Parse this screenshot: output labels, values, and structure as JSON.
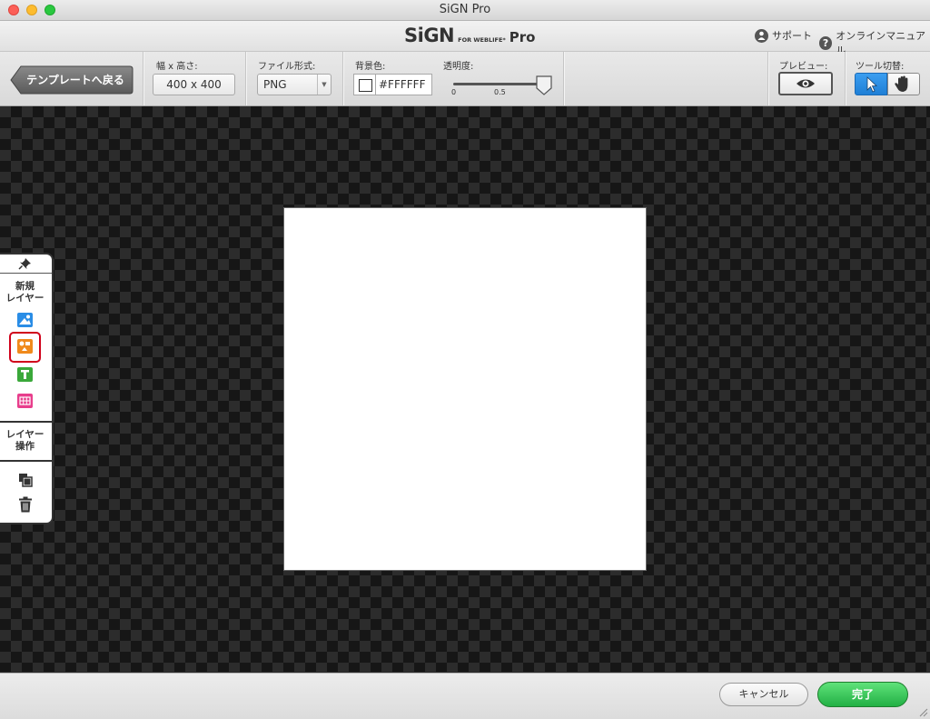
{
  "window": {
    "title": "SiGN Pro"
  },
  "header": {
    "logo_main": "SiGN",
    "logo_sub": "FOR WEBLIFE*",
    "logo_pro": "Pro",
    "support_label": "サポート",
    "manual_label": "オンラインマニュアル"
  },
  "toolbar": {
    "back_label": "テンプレートへ戻る",
    "size_label": "幅 x 高さ:",
    "size_value": "400 x 400",
    "format_label": "ファイル形式:",
    "format_value": "PNG",
    "bg_label": "背景色:",
    "bg_value": "#FFFFFF",
    "opacity_label": "透明度:",
    "opacity_min": "0",
    "opacity_mid": "0.5",
    "opacity_value": 1.0,
    "preview_label": "プレビュー:",
    "tool_label": "ツール切替:"
  },
  "side_panel": {
    "new_layer_label_1": "新規",
    "new_layer_label_2": "レイヤー",
    "layer_ops_label_1": "レイヤー",
    "layer_ops_label_2": "操作",
    "icons": [
      "pin-icon",
      "image-layer-icon",
      "shape-layer-icon",
      "text-layer-icon",
      "table-layer-icon",
      "duplicate-icon",
      "trash-icon"
    ]
  },
  "footer": {
    "cancel_label": "キャンセル",
    "done_label": "完了"
  },
  "colors": {
    "accent": "#1f7fd6",
    "done": "#22b044",
    "image_icon": "#2a8de6",
    "shape_icon": "#f08a1c",
    "text_icon": "#3aa83a",
    "table_icon": "#e83e8c",
    "selected_outline": "#d0021b"
  }
}
